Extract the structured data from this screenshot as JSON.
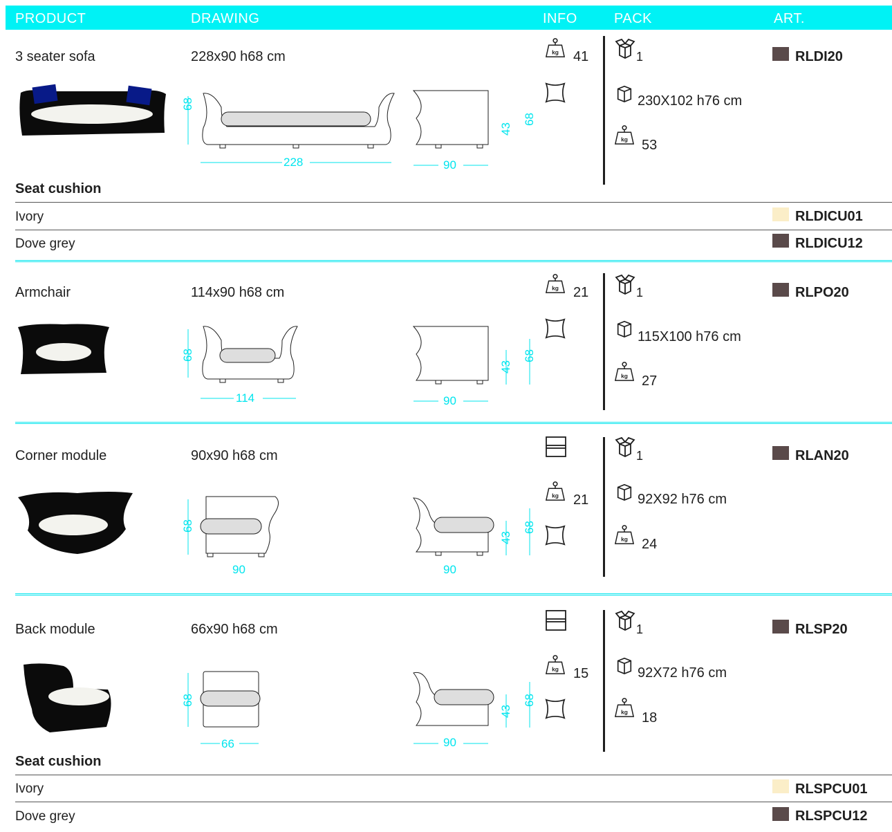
{
  "header": {
    "product": "PRODUCT",
    "drawing": "DRAWING",
    "info": "INFO",
    "pack": "PACK",
    "art": "ART."
  },
  "colors": {
    "header_bg": "#00f2f5",
    "dims": "#00e5ee",
    "dove_grey": "#5a4a4a",
    "ivory": "#fbeec8"
  },
  "products": [
    {
      "name": "3 seater sofa",
      "size": "228x90 h68 cm",
      "weight": "41",
      "pack_qty": "1",
      "pack_size": "230X102 h76 cm",
      "pack_weight": "53",
      "art": "RLDI20",
      "dims": {
        "height": "68",
        "front_width": "228",
        "side_depth": "90",
        "seat_height": "43",
        "side_height": "68"
      }
    },
    {
      "name": "Armchair",
      "size": "114x90 h68 cm",
      "weight": "21",
      "pack_qty": "1",
      "pack_size": "115X100 h76 cm",
      "pack_weight": "27",
      "art": "RLPO20",
      "dims": {
        "height": "68",
        "front_width": "114",
        "side_depth": "90",
        "seat_height": "43",
        "side_height": "68"
      }
    },
    {
      "name": "Corner module",
      "size": "90x90 h68 cm",
      "weight": "21",
      "pack_qty": "1",
      "pack_size": "92X92 h76 cm",
      "pack_weight": "24",
      "art": "RLAN20",
      "dims": {
        "height": "68",
        "front_width": "90",
        "side_depth": "90",
        "seat_height": "43",
        "side_height": "68"
      }
    },
    {
      "name": "Back module",
      "size": "66x90 h68 cm",
      "weight": "15",
      "pack_qty": "1",
      "pack_size": "92X72 h76 cm",
      "pack_weight": "18",
      "art": "RLSP20",
      "dims": {
        "height": "68",
        "front_width": "66",
        "side_depth": "90",
        "seat_height": "43",
        "side_height": "68"
      }
    }
  ],
  "cushions": [
    {
      "title": "Seat cushion",
      "rows": [
        {
          "color": "Ivory",
          "art": "RLDICU01"
        },
        {
          "color": "Dove grey",
          "art": "RLDICU12"
        }
      ]
    },
    {
      "title": "Seat cushion",
      "rows": [
        {
          "color": "Ivory",
          "art": "RLSPCU01"
        },
        {
          "color": "Dove grey",
          "art": "RLSPCU12"
        }
      ]
    }
  ]
}
